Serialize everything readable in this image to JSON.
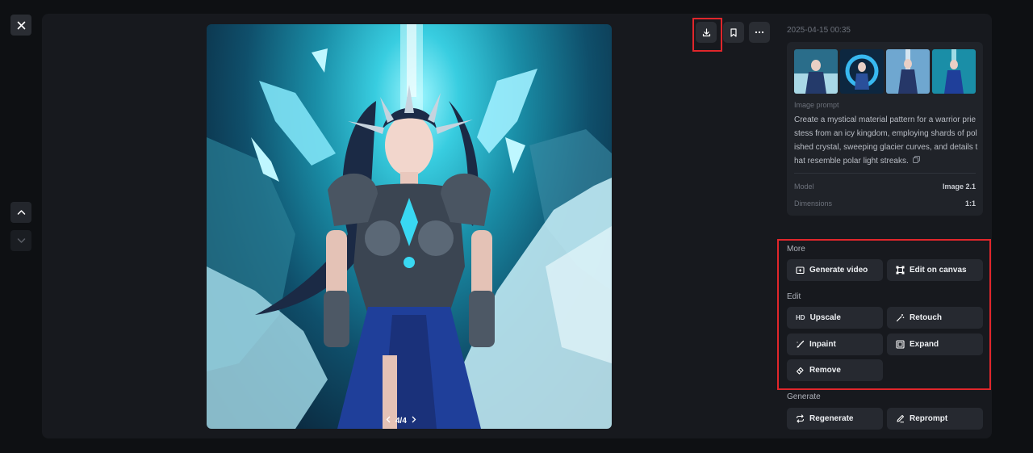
{
  "controls": {
    "close_icon": "x-icon",
    "nav_up_icon": "chevron-up-icon",
    "nav_down_icon": "chevron-down-icon"
  },
  "viewer": {
    "pager": {
      "current": 4,
      "total": 4,
      "label": "4/4"
    },
    "toolbar": {
      "download_icon": "download-icon",
      "bookmark_icon": "bookmark-icon",
      "more_icon": "more-horizontal-icon"
    }
  },
  "details": {
    "timestamp": "2025-04-15 00:35",
    "prompt_label": "Image prompt",
    "prompt_text": "Create a mystical material pattern for a warrior priestess from an icy kingdom, employing shards of polished crystal, sweeping glacier curves, and details that resemble polar light streaks.",
    "meta": [
      {
        "key": "Model",
        "value": "Image 2.1"
      },
      {
        "key": "Dimensions",
        "value": "1:1"
      }
    ]
  },
  "sections": {
    "more": {
      "label": "More",
      "buttons": [
        {
          "label": "Generate video",
          "icon": "video-plus-icon"
        },
        {
          "label": "Edit on canvas",
          "icon": "canvas-icon"
        }
      ]
    },
    "edit": {
      "label": "Edit",
      "buttons": [
        {
          "label": "Upscale",
          "icon": "hd-icon",
          "glyph": "HD"
        },
        {
          "label": "Retouch",
          "icon": "magic-wand-icon"
        },
        {
          "label": "Inpaint",
          "icon": "brush-icon"
        },
        {
          "label": "Expand",
          "icon": "expand-icon"
        },
        {
          "label": "Remove",
          "icon": "eraser-icon"
        }
      ]
    },
    "generate": {
      "label": "Generate",
      "buttons": [
        {
          "label": "Regenerate",
          "icon": "refresh-icon"
        },
        {
          "label": "Reprompt",
          "icon": "pen-icon"
        }
      ]
    }
  },
  "colors": {
    "background": "#0e1013",
    "panel": "#17191e",
    "card": "#202329",
    "button": "#262930",
    "highlight": "#e0262b"
  }
}
